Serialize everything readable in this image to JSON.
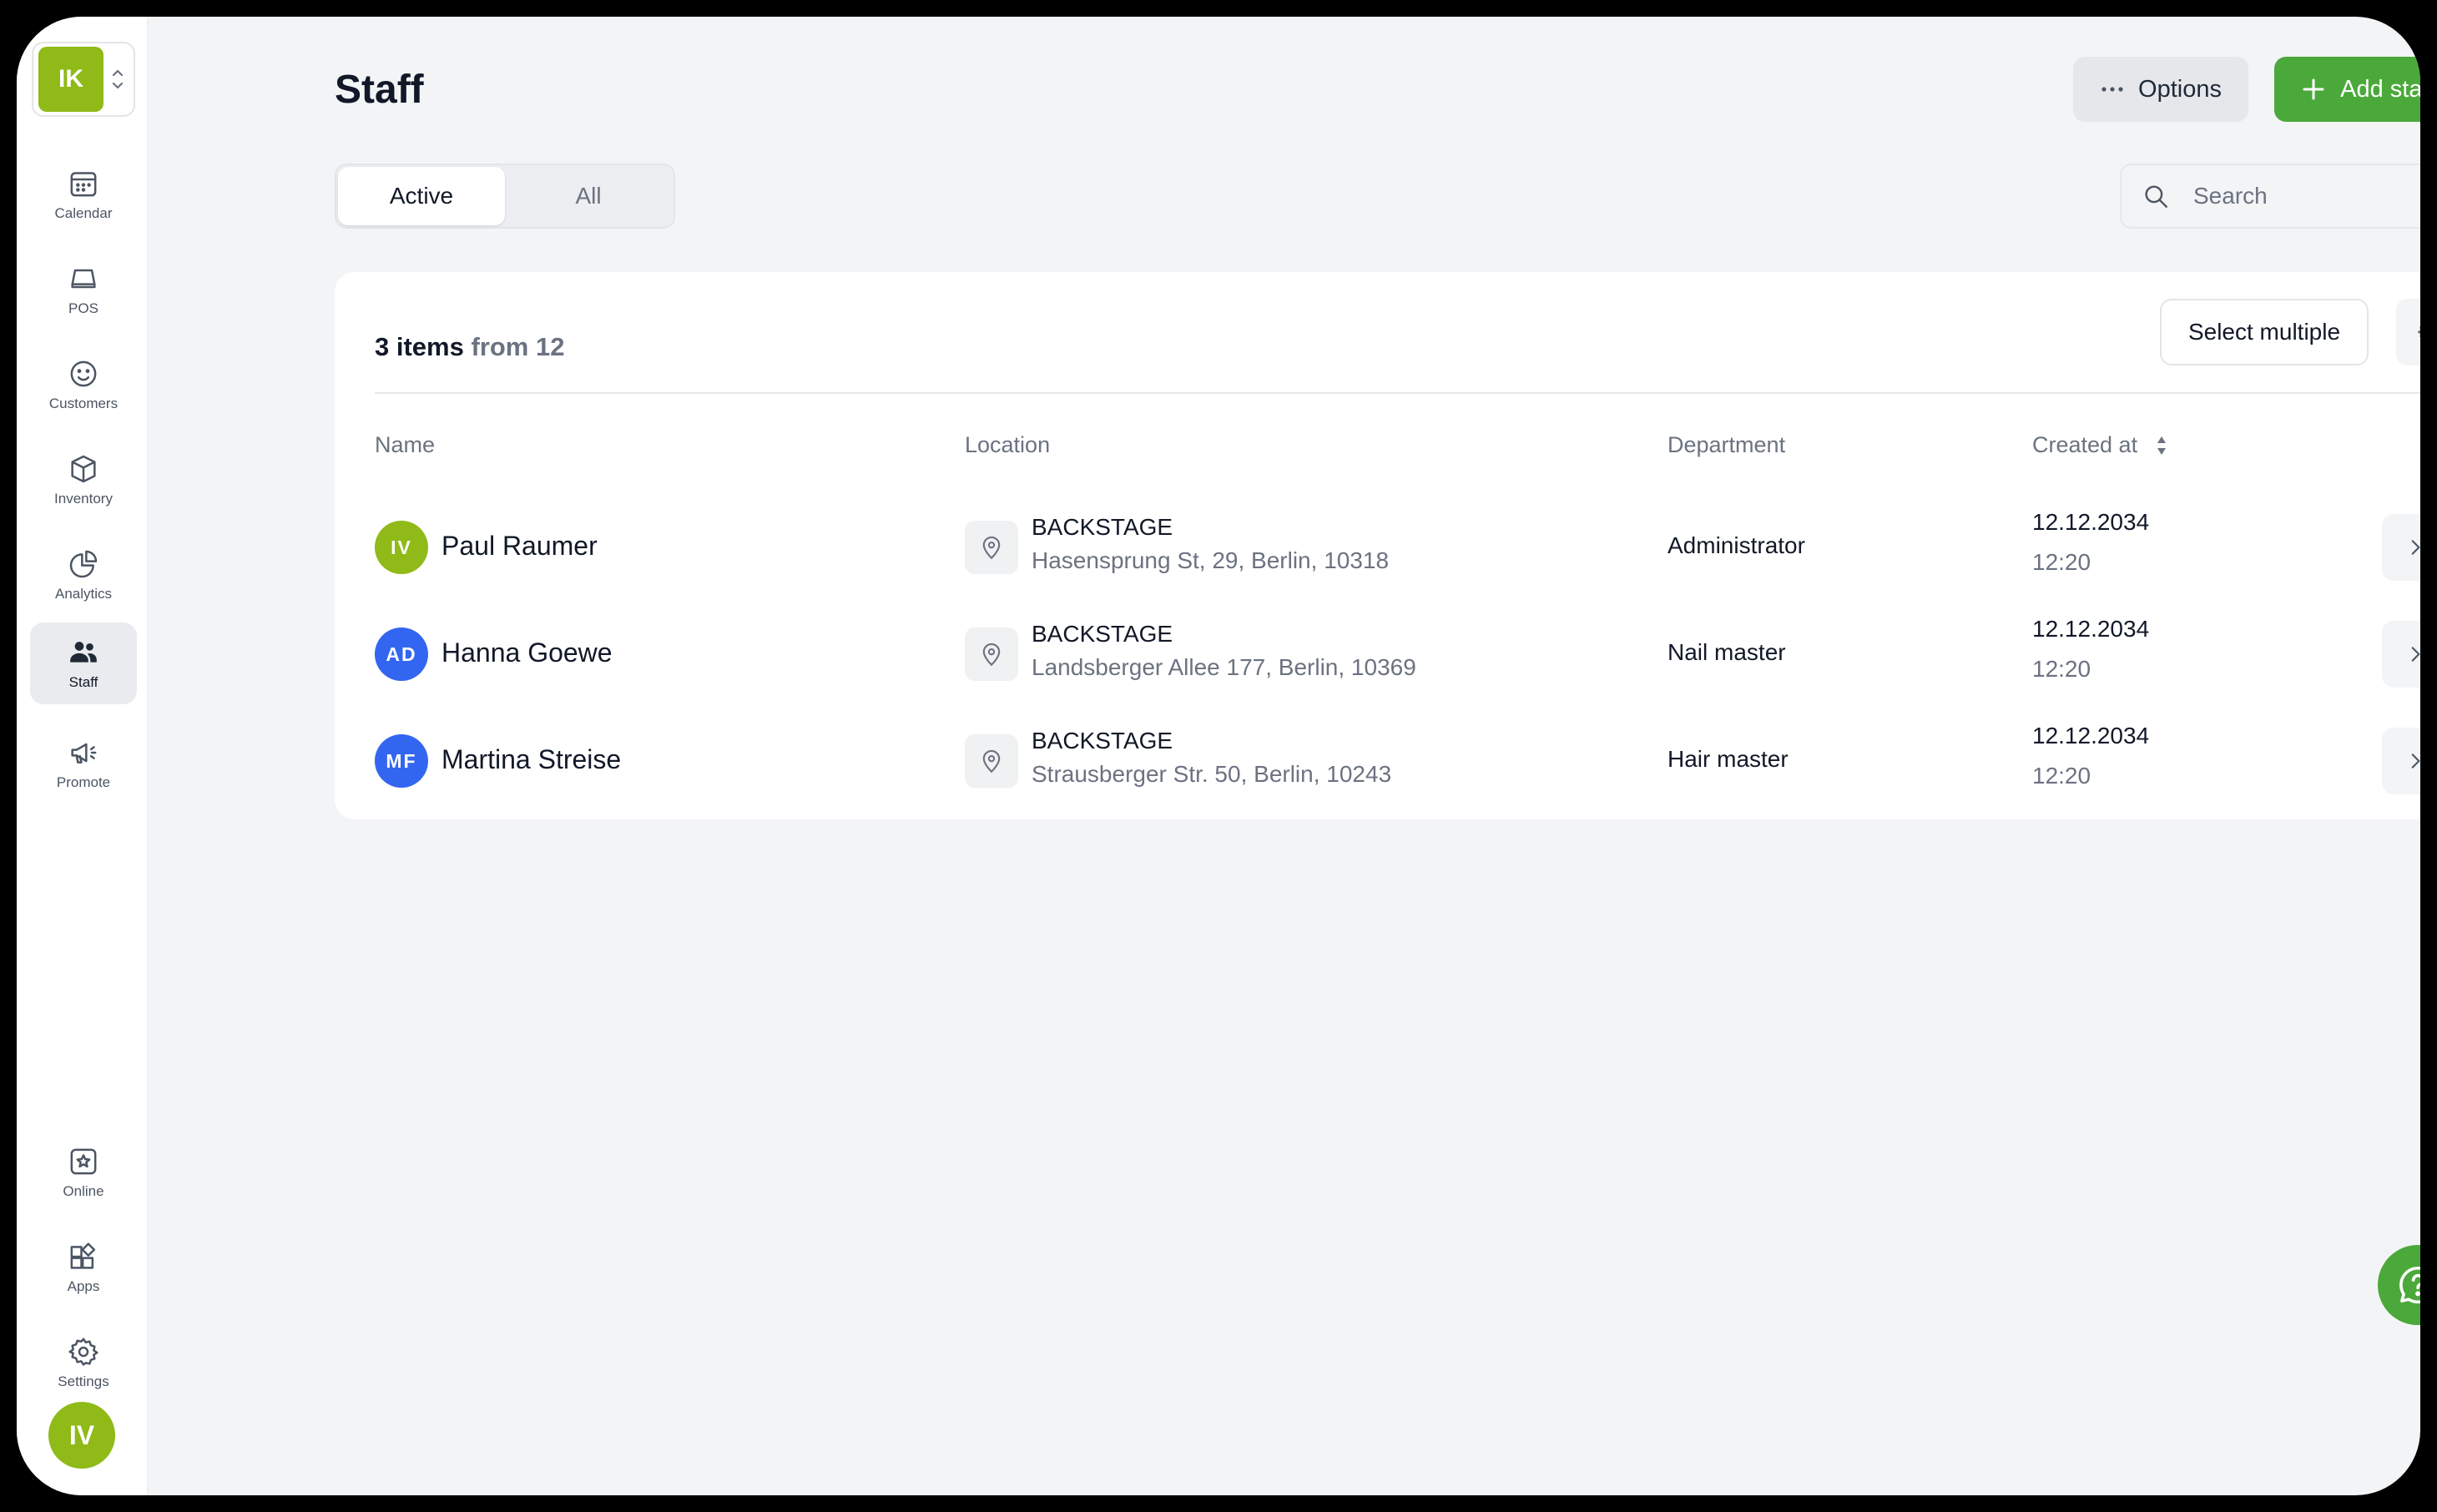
{
  "workspace": {
    "initials": "IK"
  },
  "sidebar": {
    "items": [
      {
        "label": "Calendar",
        "icon": "calendar-icon"
      },
      {
        "label": "POS",
        "icon": "pos-icon"
      },
      {
        "label": "Customers",
        "icon": "smile-icon"
      },
      {
        "label": "Inventory",
        "icon": "box-icon"
      },
      {
        "label": "Analytics",
        "icon": "pie-chart-icon"
      },
      {
        "label": "Staff",
        "icon": "users-icon",
        "active": true
      },
      {
        "label": "Promote",
        "icon": "megaphone-icon"
      }
    ],
    "bottom_items": [
      {
        "label": "Online",
        "icon": "star-icon"
      },
      {
        "label": "Apps",
        "icon": "apps-icon"
      },
      {
        "label": "Settings",
        "icon": "gear-icon"
      }
    ],
    "user_initials": "IV"
  },
  "header": {
    "title": "Staff",
    "options_label": "Options",
    "add_label": "Add staffer"
  },
  "filters": {
    "tabs": [
      "Active",
      "All"
    ],
    "active_tab": "Active",
    "search_placeholder": "Search",
    "search_value": ""
  },
  "list": {
    "count": "3 items",
    "total": "from 12",
    "select_multiple_label": "Select multiple",
    "columns": [
      "Name",
      "Location",
      "Department",
      "Created at"
    ],
    "rows": [
      {
        "initials": "IV",
        "avatar_color": "#8fba18",
        "name": "Paul Raumer",
        "location_name": "BACKSTAGE",
        "location_address": "Hasensprung St, 29, Berlin, 10318",
        "department": "Administrator",
        "date": "12.12.2034",
        "time": "12:20"
      },
      {
        "initials": "AD",
        "avatar_color": "#3366f0",
        "name": "Hanna Goewe",
        "location_name": "BACKSTAGE",
        "location_address": "Landsberger Allee 177, Berlin, 10369",
        "department": "Nail master",
        "date": "12.12.2034",
        "time": "12:20"
      },
      {
        "initials": "MF",
        "avatar_color": "#3366f0",
        "name": "Martina Streise",
        "location_name": "BACKSTAGE",
        "location_address": "Strausberger Str. 50, Berlin, 10243",
        "department": "Hair master",
        "date": "12.12.2034",
        "time": "12:20"
      }
    ]
  },
  "colors": {
    "accent_green": "#4aa93a",
    "lime": "#8fba18",
    "blue": "#3366f0"
  }
}
